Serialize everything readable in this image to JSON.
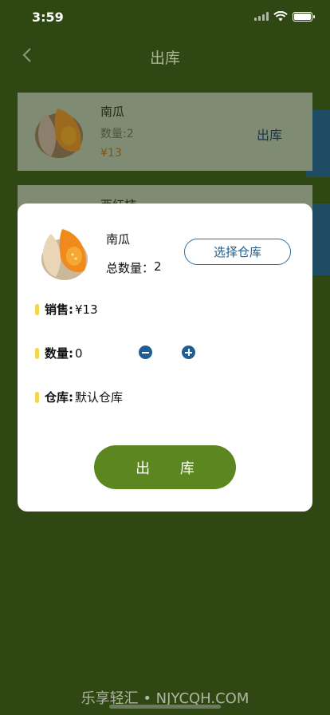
{
  "status_bar": {
    "time": "3:59"
  },
  "nav": {
    "title": "出库"
  },
  "list": [
    {
      "name": "南瓜",
      "qty": "数量:2",
      "price": "¥13",
      "action": "出库"
    },
    {
      "name": "西红柿"
    }
  ],
  "modal": {
    "product_name": "南瓜",
    "total_label": "总数量：",
    "total_value": "2",
    "choose_warehouse": "选择仓库",
    "sale_label": "销售:",
    "sale_value": "¥13",
    "qty_label": "数量:",
    "qty_value": "0",
    "warehouse_label": "仓库:",
    "warehouse_value": "默认仓库",
    "submit": "出 库"
  },
  "watermark": "乐享轻汇 • NJYCQH.COM",
  "colors": {
    "accent_green": "#5c8620",
    "accent_blue": "#1e5e93",
    "marker_yellow": "#f2d64b"
  }
}
